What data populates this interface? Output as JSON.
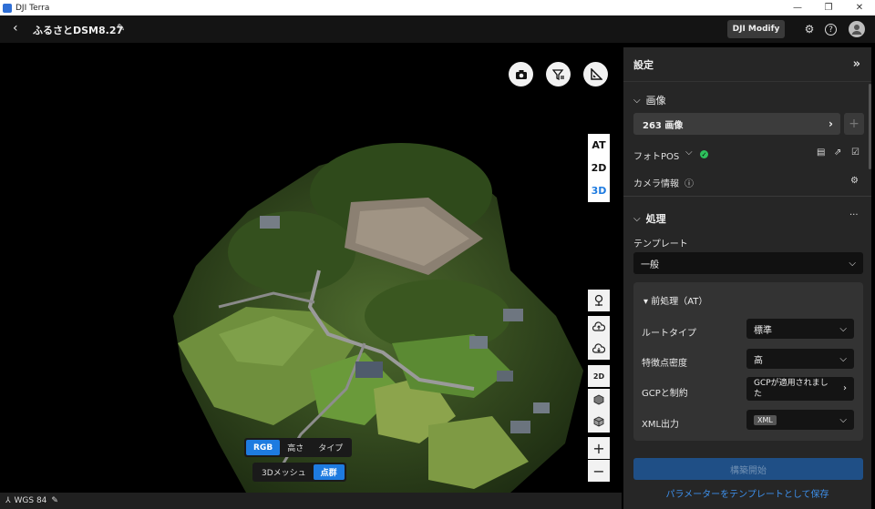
{
  "window": {
    "title": "DJI Terra",
    "controls": [
      "—",
      "❐",
      "✕"
    ]
  },
  "header": {
    "back": "‹",
    "project_title": "ふるさとDSM8.27",
    "edit": "✎",
    "modify_button": "DJI Modify",
    "settings": "⚙",
    "help": "?"
  },
  "viewport": {
    "view_modes": [
      "AT",
      "2D",
      "3D"
    ],
    "active_view": "3D",
    "tools": {
      "tool_2d": "2D",
      "zoom_in": "+",
      "zoom_out": "−"
    },
    "color_modes": [
      "RGB",
      "高さ",
      "タイプ"
    ],
    "active_color_mode": "RGB",
    "model_types": [
      "3Dメッシュ",
      "点群"
    ],
    "active_model_type": "点群"
  },
  "status_bar": {
    "crs": "WGS 84",
    "edit": "✎"
  },
  "panel": {
    "title": "設定",
    "collapse": "»",
    "images": {
      "section": "画像",
      "count_label": "263 画像",
      "add": "+",
      "photo_pos": "フォトPOS",
      "camera_info": "カメラ情報",
      "info": "ⓘ"
    },
    "processing": {
      "section": "処理",
      "more": "···",
      "template_label": "テンプレート",
      "template_value": "一般",
      "preprocess": {
        "title": "前処理（AT）",
        "route_type_label": "ルートタイプ",
        "route_type_value": "標準",
        "feature_density_label": "特徴点密度",
        "feature_density_value": "高",
        "gcp_label": "GCPと制約",
        "gcp_value": "GCPが適用されました",
        "xml_label": "XML出力",
        "xml_value": "XML"
      }
    },
    "start_button": "構築開始",
    "save_template_link": "パラメーターをテンプレートとして保存"
  }
}
